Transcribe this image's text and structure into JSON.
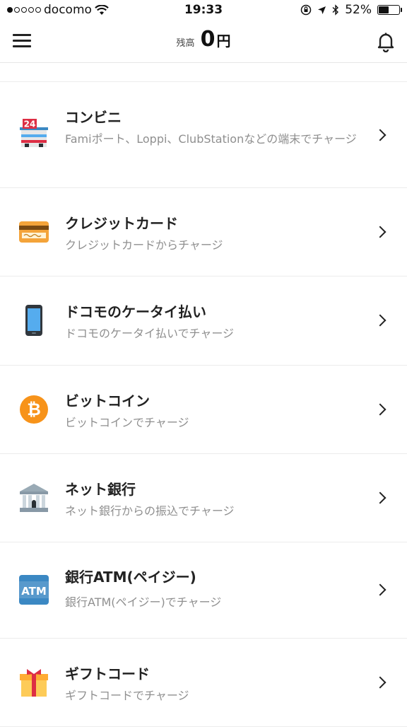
{
  "status_bar": {
    "carrier": "docomo",
    "time": "19:33",
    "battery_percent": "52%",
    "battery_level": 0.52,
    "signal_bars_filled": 1,
    "signal_bars_total": 5
  },
  "header": {
    "balance_label": "残高",
    "balance_value": "0",
    "balance_unit": "円"
  },
  "charge_methods": [
    {
      "title": "コンビニ",
      "description": "Famiポート、Loppi、ClubStationなどの端末でチャージ",
      "icon": "convenience-store-icon"
    },
    {
      "title": "クレジットカード",
      "description": "クレジットカードからチャージ",
      "icon": "credit-card-icon"
    },
    {
      "title": "ドコモのケータイ払い",
      "description": "ドコモのケータイ払いでチャージ",
      "icon": "mobile-phone-icon"
    },
    {
      "title": "ビットコイン",
      "description": "ビットコインでチャージ",
      "icon": "bitcoin-icon"
    },
    {
      "title": "ネット銀行",
      "description": "ネット銀行からの振込でチャージ",
      "icon": "bank-icon"
    },
    {
      "title": "銀行ATM(ペイジー)",
      "description": "銀行ATM(ペイジー)でチャージ",
      "icon": "atm-icon"
    },
    {
      "title": "ギフトコード",
      "description": "ギフトコードでチャージ",
      "icon": "gift-icon"
    }
  ],
  "icon_texts": {
    "store_number": "24",
    "atm_label": "ATM",
    "bitcoin_symbol": "₿"
  },
  "colors": {
    "bitcoin": "#f7931a",
    "atm": "#3b88c3",
    "card": "#f4a43a",
    "gift_ribbon": "#dd2e44",
    "gift_box": "#fdcb58"
  }
}
